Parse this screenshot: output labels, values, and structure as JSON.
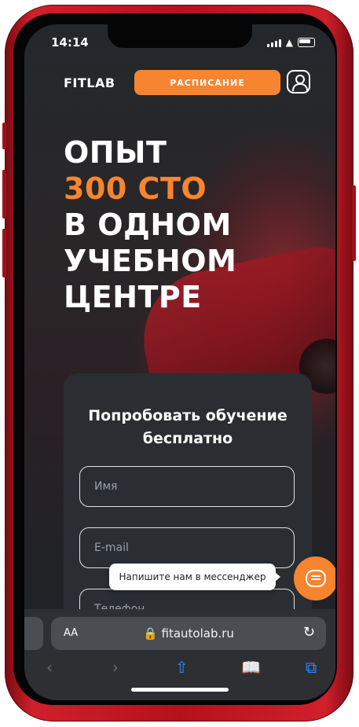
{
  "status_bar": {
    "time": "14:14"
  },
  "header": {
    "logo": "FITLAB",
    "schedule_button": "РАСПИСАНИЕ"
  },
  "hero": {
    "line1": "ОПЫТ",
    "line2_accent": "300 СТО",
    "line3": "В ОДНОМ",
    "line4": "УЧЕБНОМ",
    "line5": "ЦЕНТРЕ"
  },
  "form": {
    "title_line1": "Попробовать обучение",
    "title_line2": "бесплатно",
    "name_placeholder": "Имя",
    "email_placeholder": "E-mail",
    "phone_placeholder": "Телефон"
  },
  "chat": {
    "tooltip": "Напишите нам в мессенджер"
  },
  "browser": {
    "text_size": "AA",
    "url": "fitautolab.ru"
  },
  "colors": {
    "accent": "#f7852f",
    "background": "#1e2226",
    "card": "#2a2e33",
    "phone_frame": "#c0141f"
  },
  "icons": [
    "user-icon",
    "chat-icon",
    "lock-icon",
    "reload-icon",
    "back-icon",
    "forward-icon",
    "share-icon",
    "bookmarks-icon",
    "tabs-icon"
  ]
}
